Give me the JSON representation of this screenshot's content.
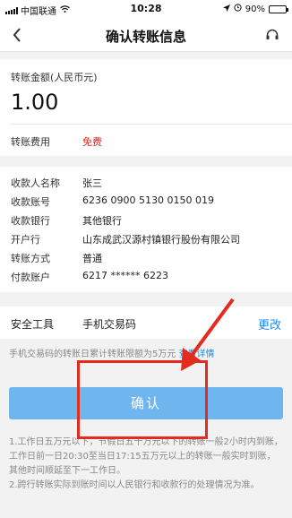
{
  "status_bar": {
    "carrier": "中国联通",
    "time": "10:28",
    "battery": "90%",
    "battery_level": 0.9
  },
  "nav": {
    "back_icon": "chevron-left-icon",
    "title": "确认转账信息",
    "service_icon": "headset-icon"
  },
  "amount": {
    "label": "转账金额(人民币元)",
    "value": "1.00",
    "fee_label": "转账费用",
    "fee_value": "免费"
  },
  "payee": {
    "rows": [
      {
        "label": "收款人名称",
        "value": "张三"
      },
      {
        "label": "收款账号",
        "value": "6236 0900 5130 0150 019"
      },
      {
        "label": "收款银行",
        "value": "其他银行"
      },
      {
        "label": "开户行",
        "value": "山东成武汉源村镇银行股份有限公司"
      },
      {
        "label": "转账方式",
        "value": "普通"
      },
      {
        "label": "付款账户",
        "value": "6217 ****** 6223"
      }
    ]
  },
  "security": {
    "label": "安全工具",
    "value": "手机交易码",
    "change": "更改"
  },
  "limit_note": {
    "text": "手机交易码的转账日累计转账限额为5万元",
    "link": "查看详情"
  },
  "confirm_button": "确认",
  "notes": [
    "1.工作日五万元以下，节假日五十万元以下的转账一般2小时内到账，工作日前一日20:30至当日17:15五万元以上的转账一般实时到账，其他时间顺延至下一工作日。",
    "2.跨行转账实际到账时间以人民银行和收款行的处理情况为准。"
  ],
  "colors": {
    "accent": "#1a8cf0",
    "button": "#6fb6ef",
    "fee": "#e2231a",
    "annotation": "#e32b1e"
  }
}
